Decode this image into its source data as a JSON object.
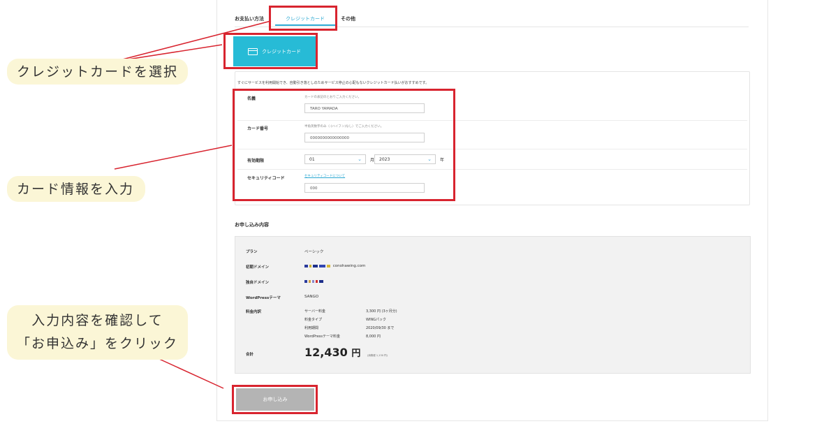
{
  "tabs": {
    "label": "お支払い方法",
    "credit": "クレジットカード",
    "other": "その他"
  },
  "cc_button_label": "クレジットカード",
  "form": {
    "description": "すぐにサービスを利用開始でき、自動引き落としのためサービス停止の心配もないクレジットカード払いがおすすめです。",
    "name_label": "名義",
    "name_hint": "カードの表記のとおりご入力ください。",
    "name_value": "TARO YAMADA",
    "number_label": "カード番号",
    "number_hint": "半角英数字のみ（-(ハイフン)なし）でご入力ください。",
    "number_value": "0000000000000000",
    "expiry_label": "有効期限",
    "month_value": "01",
    "month_unit": "月",
    "year_value": "2023",
    "year_unit": "年",
    "security_label": "セキュリティコード",
    "security_link": "セキュリティコードについて",
    "security_value": "000"
  },
  "summary": {
    "title": "お申し込み内容",
    "plan_label": "プラン",
    "plan_value": "ベーシック",
    "initial_domain_label": "初期ドメイン",
    "initial_domain_suffix": "conohawing.com",
    "own_domain_label": "独自ドメイン",
    "theme_label": "WordPressテーマ",
    "theme_value": "SANGO",
    "fee_label": "料金内訳",
    "fees": [
      {
        "name": "サーバー料金",
        "value": "3,300 円 (3ヶ月分)"
      },
      {
        "name": "料金タイプ",
        "value": "WINGパック"
      },
      {
        "name": "利用期間",
        "value": "2020/09/30 まで"
      },
      {
        "name": "WordPressテーマ料金",
        "value": "8,000 円"
      }
    ],
    "total_label": "合計",
    "total_amount": "12,430",
    "total_unit": "円",
    "total_tax": "(消費税 1,130 円)"
  },
  "submit_label": "お申し込み",
  "annotations": {
    "select_card": "クレジットカードを選択",
    "enter_card": "カード情報を入力",
    "confirm_line1": "入力内容を確認して",
    "confirm_line2": "「お申込み」をクリック"
  },
  "colors": {
    "accent": "#27bbd6",
    "highlight": "#d8242f",
    "callout_bg": "#fbf6d6"
  }
}
